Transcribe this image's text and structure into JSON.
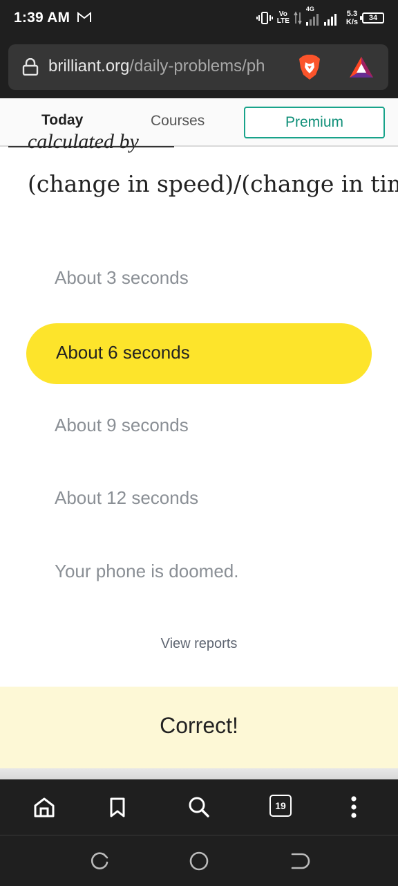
{
  "status_bar": {
    "time": "1:39 AM",
    "volte_top": "Vo",
    "volte_bottom": "LTE",
    "network": "4G",
    "speed_value": "5.3",
    "speed_unit": "K/s",
    "battery": "34",
    "icons": [
      "gmail-icon",
      "vibrate-icon",
      "data-arrows-icon",
      "signal-icon",
      "battery-icon"
    ]
  },
  "browser": {
    "url_domain": "brilliant.org",
    "url_path": "/daily-problems/ph",
    "icons": [
      "lock-icon",
      "brave-lion-icon",
      "bat-rewards-icon"
    ]
  },
  "site_nav": {
    "today": "Today",
    "courses": "Courses",
    "premium": "Premium"
  },
  "problem": {
    "partial_text": "calculated by",
    "formula": "(change in speed)/(change in tim"
  },
  "options": [
    {
      "label": "About 3 seconds",
      "selected": false
    },
    {
      "label": "About 6 seconds",
      "selected": true
    },
    {
      "label": "About 9 seconds",
      "selected": false
    },
    {
      "label": "About 12 seconds",
      "selected": false
    },
    {
      "label": "Your phone is doomed.",
      "selected": false
    }
  ],
  "view_reports": "View reports",
  "result": {
    "message": "Correct!"
  },
  "toolbar": {
    "tab_count": "19",
    "icons": [
      "home-icon",
      "bookmark-icon",
      "search-icon",
      "tabs-icon",
      "menu-dots-icon"
    ]
  },
  "nav_bar": {
    "icons": [
      "recent-apps-icon",
      "home-circle-icon",
      "back-icon"
    ]
  },
  "colors": {
    "selected_option": "#fde42b",
    "correct_banner": "#fdf8d6",
    "premium_accent": "#18a38a",
    "chrome_dark": "#1f1f1f"
  }
}
